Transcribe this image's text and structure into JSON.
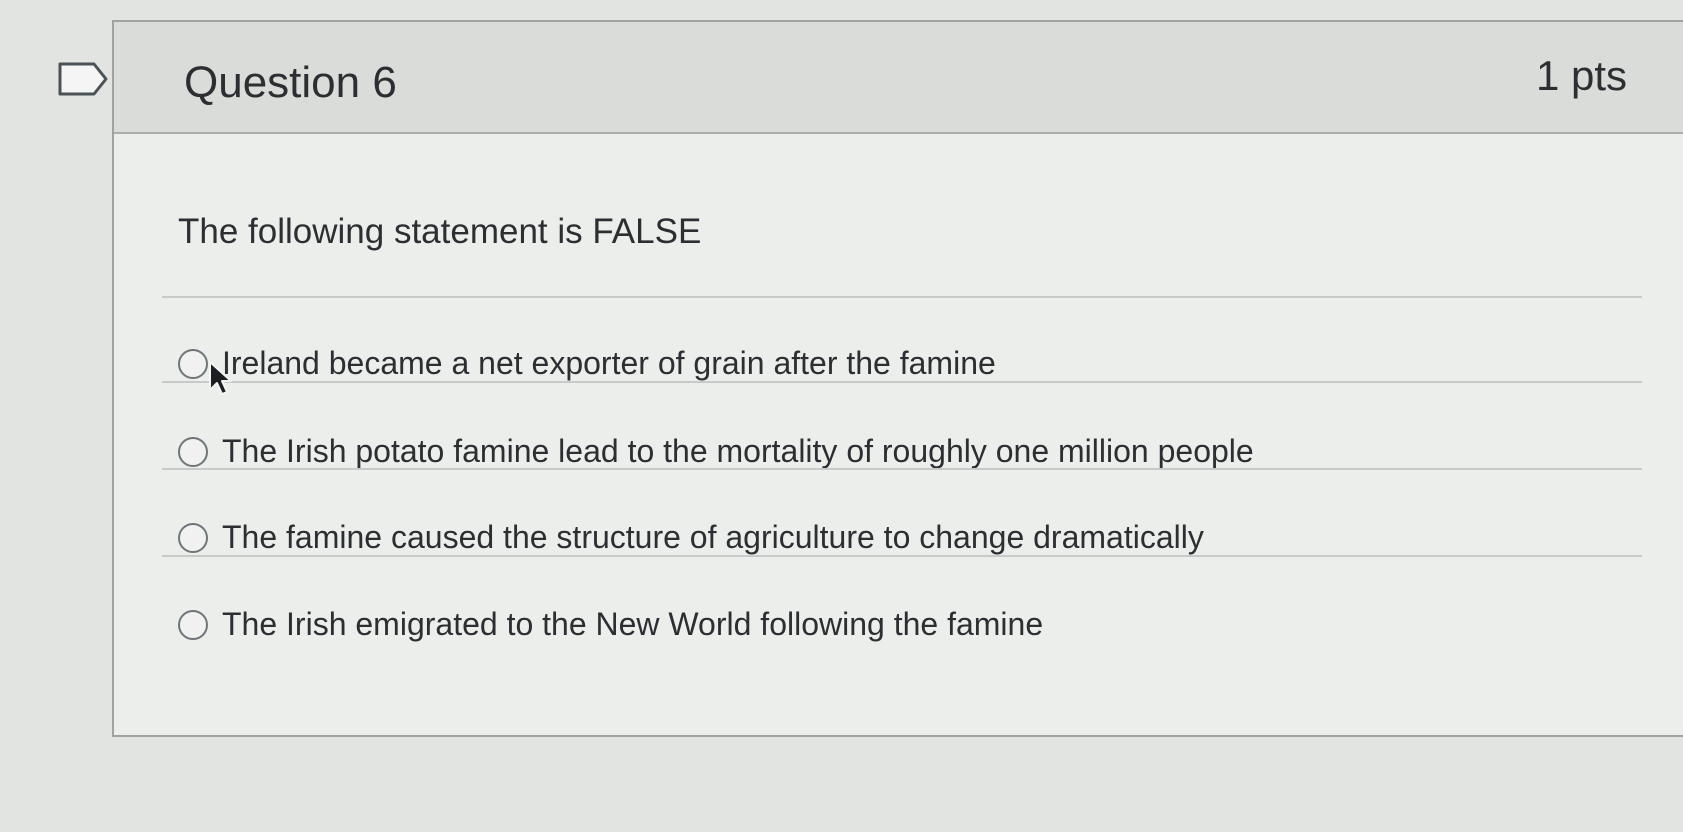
{
  "question": {
    "title": "Question 6",
    "points": "1 pts",
    "text": "The following statement is FALSE"
  },
  "answers": [
    {
      "label": "Ireland became a net exporter of grain after the famine",
      "selected": false
    },
    {
      "label": "The Irish potato famine lead to the mortality of roughly one million people",
      "selected": false
    },
    {
      "label": "The famine caused the structure of agriculture to change dramatically",
      "selected": false
    },
    {
      "label": "The Irish emigrated to the New World following the famine",
      "selected": false
    }
  ],
  "icons": {
    "flag": "bookmark-flag-icon",
    "cursor": "mouse-pointer-icon"
  },
  "colors": {
    "background": "#e2e4e2",
    "card": "#eceeec",
    "header": "#dadcda",
    "text": "#2b2f32",
    "border": "#9ea3a1"
  }
}
